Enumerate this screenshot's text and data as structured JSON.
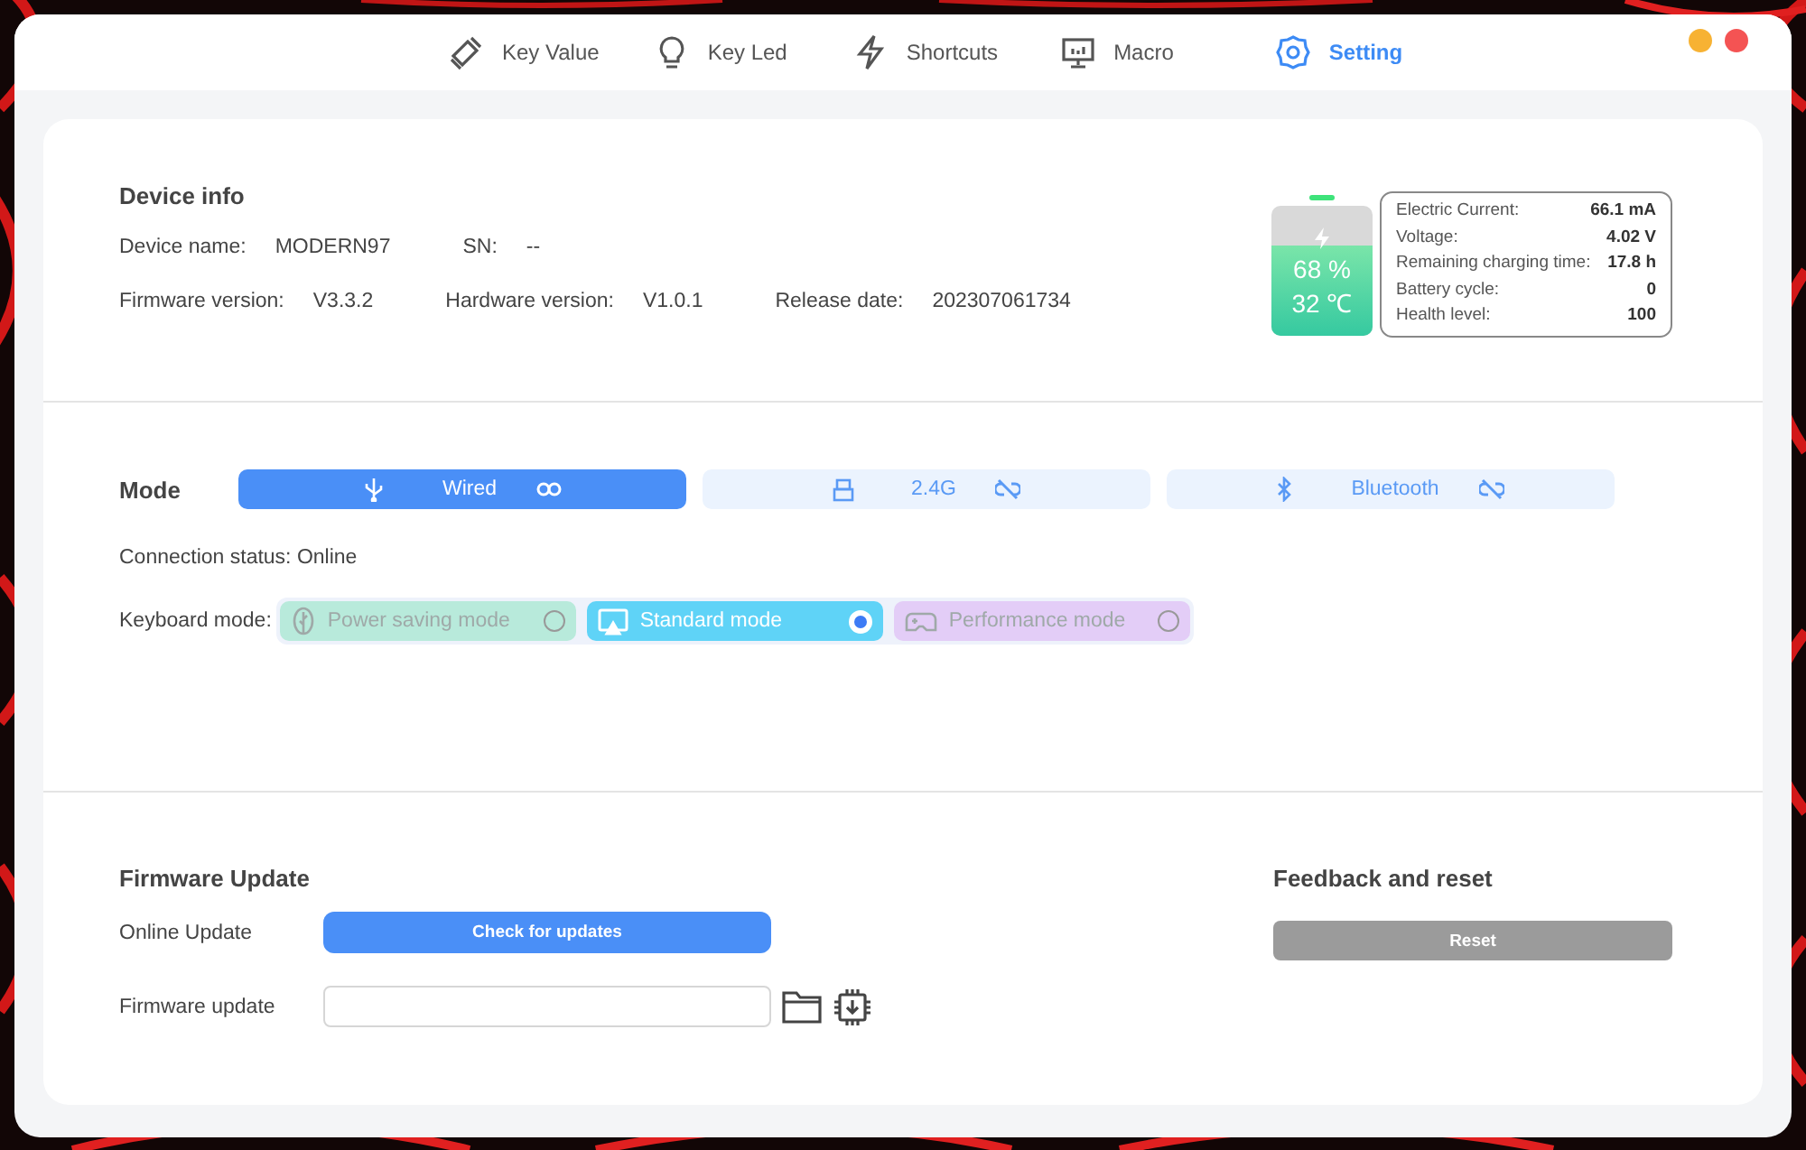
{
  "tabs": [
    {
      "label": "Key Value",
      "selected": false
    },
    {
      "label": "Key Led",
      "selected": false
    },
    {
      "label": "Shortcuts",
      "selected": false
    },
    {
      "label": "Macro",
      "selected": false
    },
    {
      "label": "Setting",
      "selected": true
    }
  ],
  "device_info": {
    "title": "Device info",
    "rows": [
      [
        {
          "label": "Device name:",
          "value": "MODERN97"
        },
        {
          "label": "SN:",
          "value": "--"
        }
      ],
      [
        {
          "label": "Firmware version:",
          "value": "V3.3.2"
        },
        {
          "label": "Hardware version:",
          "value": "V1.0.1"
        },
        {
          "label": "Release date:",
          "value": "202307061734"
        }
      ]
    ]
  },
  "battery": {
    "level": 0.7,
    "percent": "68 %",
    "temperature": "32 ℃",
    "charging": true
  },
  "battery_stats": [
    {
      "label": "Electric Current:",
      "value": "66.1 mA"
    },
    {
      "label": "Voltage:",
      "value": "4.02 V"
    },
    {
      "label": "Remaining charging time:",
      "value": "17.8 h"
    },
    {
      "label": "Battery cycle:",
      "value": "0"
    },
    {
      "label": "Health level:",
      "value": "100"
    }
  ],
  "mode": {
    "title": "Mode",
    "connections": [
      {
        "kind": "usb",
        "label": "Wired",
        "selected": true,
        "linked": true
      },
      {
        "kind": "dongle",
        "label": "2.4G",
        "selected": false,
        "linked": false
      },
      {
        "kind": "bluetooth",
        "label": "Bluetooth",
        "selected": false,
        "linked": false
      }
    ],
    "status": "Connection status: Online",
    "keyboard_label": "Keyboard mode:",
    "keyboard_modes": [
      {
        "kind": "leaf",
        "label": "Power saving mode",
        "selected": false,
        "color": "#b8eadb"
      },
      {
        "kind": "screen",
        "label": "Standard mode",
        "selected": true,
        "color": "#5fd3f7"
      },
      {
        "kind": "gamepad",
        "label": "Performance mode",
        "selected": false,
        "color": "#e3cdf7"
      }
    ]
  },
  "firmware": {
    "title": "Firmware Update",
    "online_label": "Online Update",
    "check_button": "Check for updates",
    "file_label": "Firmware update"
  },
  "feedback": {
    "title": "Feedback and reset",
    "reset_button": "Reset",
    "disabled": true
  }
}
